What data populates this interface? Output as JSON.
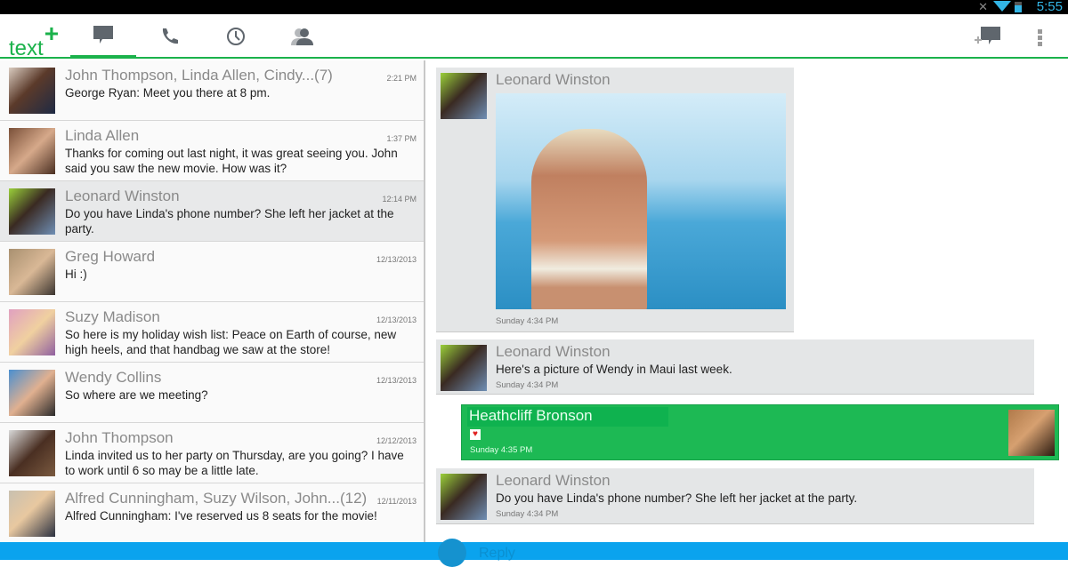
{
  "status_bar": {
    "time": "5:55"
  },
  "app": {
    "logo": "text",
    "logo_plus": "+"
  },
  "tabs": [
    {
      "name": "messages",
      "icon": "chat-icon",
      "active": true
    },
    {
      "name": "calls",
      "icon": "phone-icon"
    },
    {
      "name": "history",
      "icon": "clock-icon"
    },
    {
      "name": "contacts",
      "icon": "contacts-icon"
    }
  ],
  "actions": {
    "new_message": "new-message-icon",
    "overflow": "overflow-menu-icon"
  },
  "conversations": [
    {
      "name": "John Thompson, Linda Allen, Cindy...(7)",
      "time": "2:21 PM",
      "message": "George Ryan: Meet you there at 8 pm."
    },
    {
      "name": "Linda Allen",
      "time": "1:37 PM",
      "message": "Thanks for coming out last night, it was great seeing you. John said you saw the new movie. How was it?"
    },
    {
      "name": "Leonard Winston",
      "time": "12:14 PM",
      "message": "Do you have Linda's phone number? She left her jacket at the party."
    },
    {
      "name": "Greg Howard",
      "time": "12/13/2013",
      "message": "Hi :)"
    },
    {
      "name": "Suzy Madison",
      "time": "12/13/2013",
      "message": "So here is my holiday wish list: Peace on Earth of course, new high heels, and that handbag we saw at the store!"
    },
    {
      "name": "Wendy Collins",
      "time": "12/13/2013",
      "message": "So where are we meeting?"
    },
    {
      "name": "John Thompson",
      "time": "12/12/2013",
      "message": "Linda invited us to her party on Thursday, are you going? I have to work until 6 so may be a little late."
    },
    {
      "name": "Alfred Cunningham, Suzy Wilson, John...(12)",
      "time": "12/11/2013",
      "message": "Alfred Cunningham: I've reserved us 8 seats for the movie!"
    }
  ],
  "thread": [
    {
      "sender": "Leonard Winston",
      "text": "",
      "time": "Sunday 4:34 PM",
      "attachment": "photo"
    },
    {
      "sender": "Leonard Winston",
      "text": "Here's a picture of Wendy in Maui last week.",
      "time": "Sunday 4:34 PM"
    },
    {
      "sender": "Heathcliff Bronson",
      "text": "heart-emoji",
      "time": "Sunday 4:35 PM",
      "outgoing": true
    },
    {
      "sender": "Leonard Winston",
      "text": "Do you have Linda's phone number? She left her jacket at the party.",
      "time": "Sunday 4:34 PM"
    }
  ],
  "compose": {
    "placeholder": "Reply"
  },
  "colors": {
    "brand": "#1bb24b",
    "reply_bar": "#0aa3ee"
  }
}
